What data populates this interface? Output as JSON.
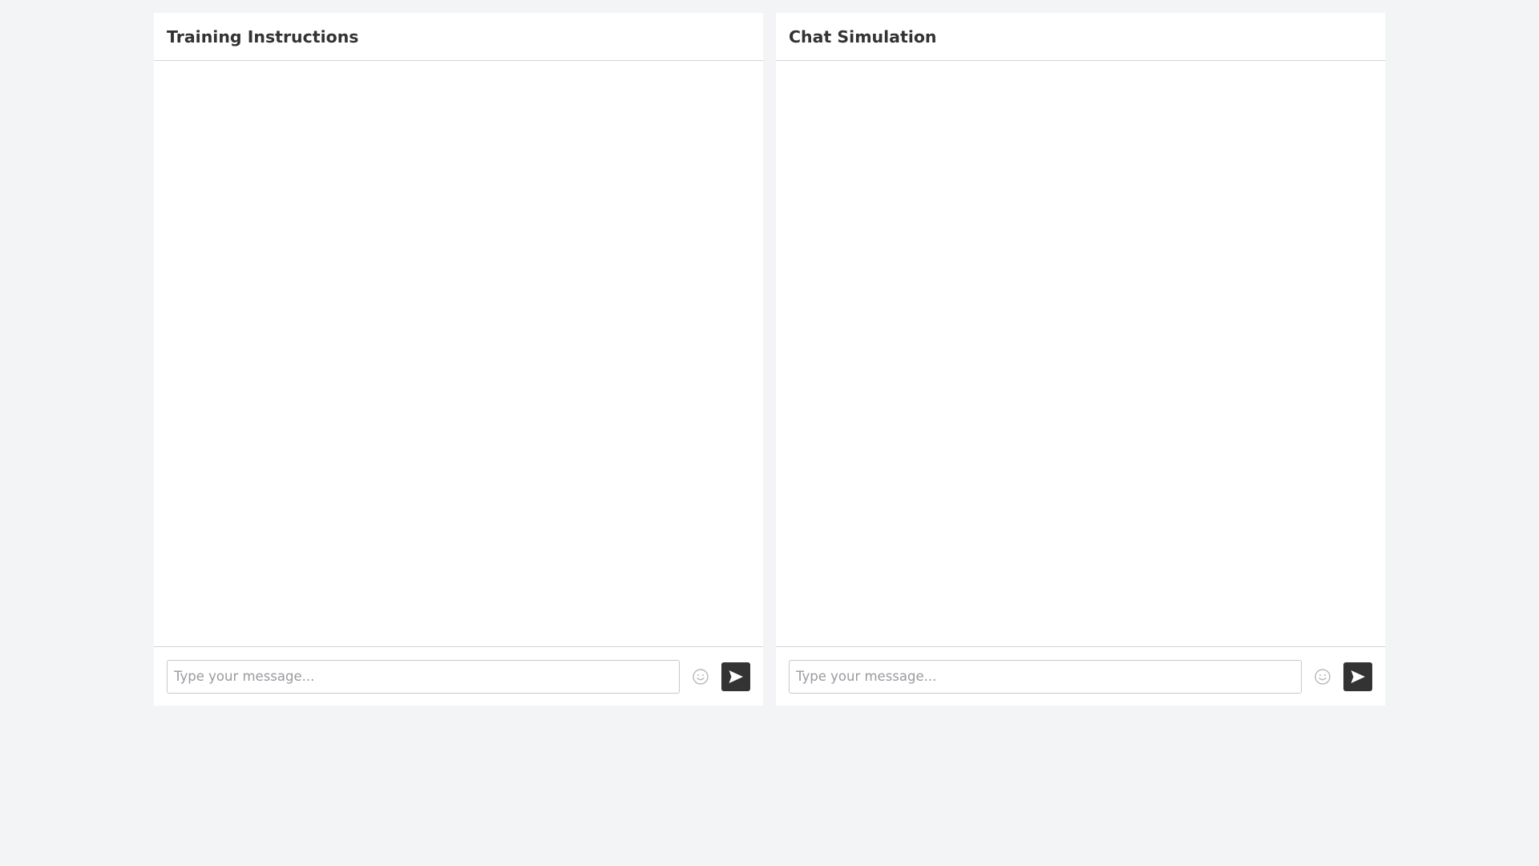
{
  "panels": [
    {
      "title": "Training Instructions",
      "input": {
        "placeholder": "Type your message...",
        "value": ""
      },
      "icons": {
        "emoji": "smiley-face-icon",
        "send": "send-arrow-icon"
      }
    },
    {
      "title": "Chat Simulation",
      "input": {
        "placeholder": "Type your message...",
        "value": ""
      },
      "icons": {
        "emoji": "smiley-face-icon",
        "send": "send-arrow-icon"
      }
    }
  ],
  "colors": {
    "background": "#f3f4f6",
    "panel": "#ffffff",
    "text": "#333333",
    "send_button": "#333333",
    "placeholder": "#9a9aa0",
    "divider": "#d4d4d8"
  }
}
